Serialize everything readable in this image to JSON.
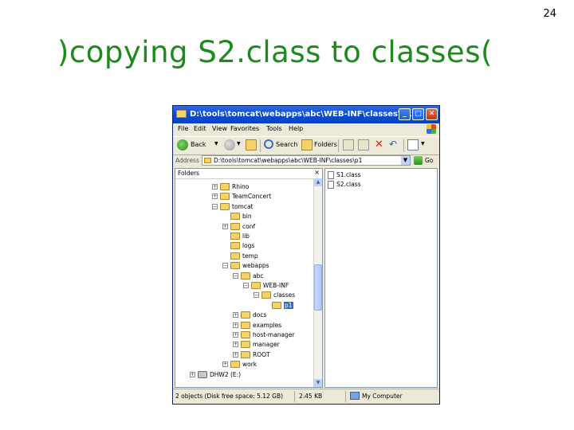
{
  "slide": {
    "number": "24",
    "title": ")copying S2.class to classes("
  },
  "window": {
    "title": "D:\\tools\\tomcat\\webapps\\abc\\WEB-INF\\classes\\p1",
    "caption_buttons": [
      "minimize",
      "maximize",
      "close"
    ],
    "menu": [
      "File",
      "Edit",
      "View",
      "Favorites",
      "Tools",
      "Help"
    ],
    "toolbar": {
      "back": "Back",
      "search": "Search",
      "folders": "Folders"
    },
    "address": {
      "label": "Address",
      "value": "D:\\tools\\tomcat\\webapps\\abc\\WEB-INF\\classes\\p1",
      "go": "Go"
    },
    "folders_pane": {
      "title": "Folders",
      "close": "×",
      "tree": [
        {
          "label": "Rhino",
          "expander": "+",
          "depth": 0
        },
        {
          "label": "TeamConcert",
          "expander": "+",
          "depth": 0
        },
        {
          "label": "tomcat",
          "expander": "−",
          "depth": 0
        },
        {
          "label": "bin",
          "expander": "",
          "depth": 1
        },
        {
          "label": "conf",
          "expander": "+",
          "depth": 1
        },
        {
          "label": "lib",
          "expander": "",
          "depth": 1
        },
        {
          "label": "logs",
          "expander": "",
          "depth": 1
        },
        {
          "label": "temp",
          "expander": "",
          "depth": 1
        },
        {
          "label": "webapps",
          "expander": "−",
          "depth": 1
        },
        {
          "label": "abc",
          "expander": "−",
          "depth": 2
        },
        {
          "label": "WEB-INF",
          "expander": "−",
          "depth": 3
        },
        {
          "label": "classes",
          "expander": "−",
          "depth": 4
        },
        {
          "label": "p1",
          "expander": "",
          "depth": 5,
          "selected": true
        },
        {
          "label": "docs",
          "expander": "+",
          "depth": 2
        },
        {
          "label": "examples",
          "expander": "+",
          "depth": 2
        },
        {
          "label": "host-manager",
          "expander": "+",
          "depth": 2
        },
        {
          "label": "manager",
          "expander": "+",
          "depth": 2
        },
        {
          "label": "ROOT",
          "expander": "+",
          "depth": 2
        },
        {
          "label": "work",
          "expander": "+",
          "depth": 1
        },
        {
          "label": "DHW2 (E:)",
          "expander": "+",
          "depth": -1,
          "drive": true
        }
      ]
    },
    "files": [
      "S1.class",
      "S2.class"
    ],
    "status": {
      "objects": "2 objects (Disk free space: 5.12 GB)",
      "size": "2.45 KB",
      "location": "My Computer"
    }
  }
}
